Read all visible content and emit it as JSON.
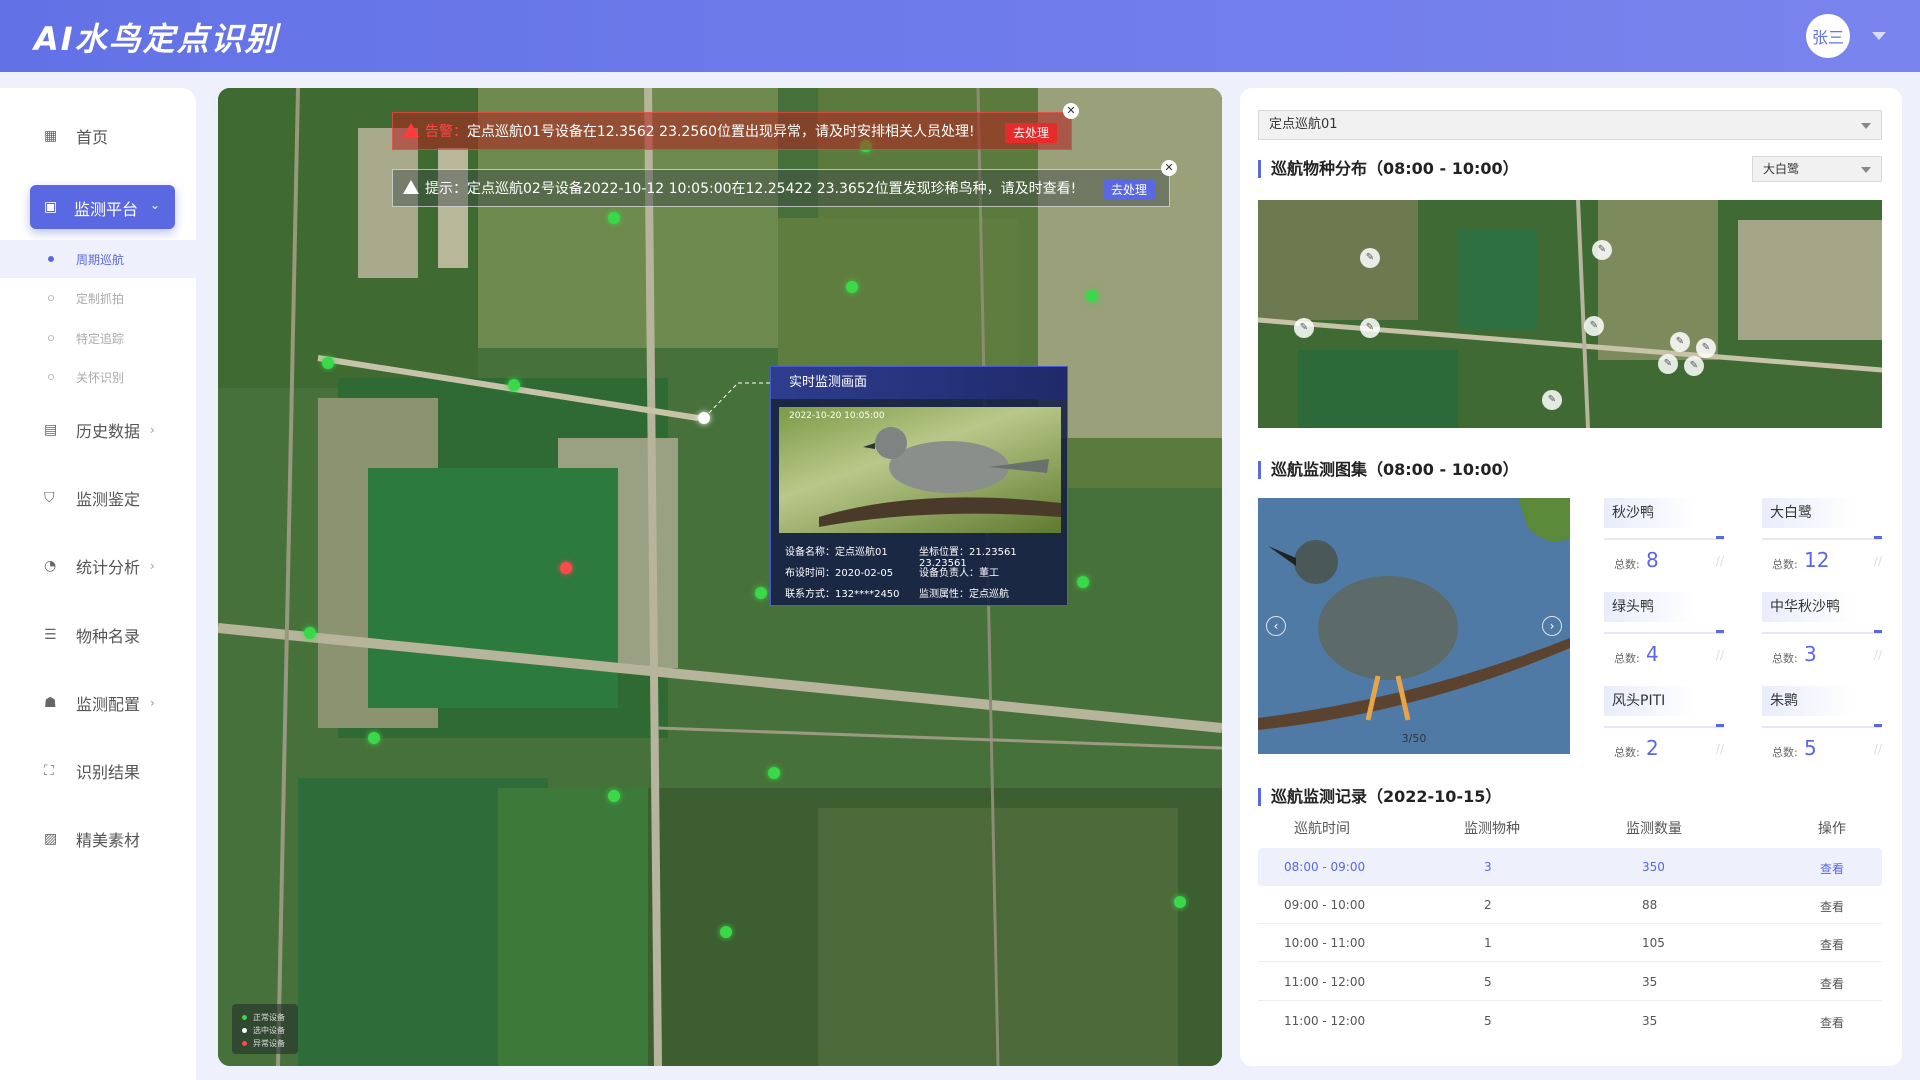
{
  "app": {
    "title": "AI水鸟定点识别",
    "user": "张三"
  },
  "nav": {
    "home": "首页",
    "monitor": "监测平台",
    "sub": [
      "周期巡航",
      "定制抓拍",
      "特定追踪",
      "关怀识别"
    ],
    "history": "历史数据",
    "appraise": "监测鉴定",
    "stats": "统计分析",
    "species": "物种名录",
    "config": "监测配置",
    "results": "识别结果",
    "media": "精美素材"
  },
  "alerts": {
    "warn": {
      "prefix": "告警：",
      "text": "定点巡航01号设备在12.3562  23.2560位置出现异常，请及时安排相关人员处理!",
      "button": "去处理"
    },
    "tip": {
      "prefix": "提示：",
      "text": "定点巡航02号设备2022-10-12 10:05:00在12.25422  23.3652位置发现珍稀鸟种，请及时查看!",
      "button": "去处理"
    }
  },
  "popup": {
    "title": "实时监测画面",
    "timestamp": "2022-10-20  10:05:00",
    "device_name_label": "设备名称：",
    "device_name": "定点巡航01",
    "coord_label": "坐标位置：",
    "coord": "21.23561  23.23561",
    "setup_label": "布设时间：",
    "setup": "2020-02-05",
    "owner_label": "设备负责人：",
    "owner": "董工",
    "contact_label": "联系方式：",
    "contact": "132****2450",
    "attr_label": "监测属性：",
    "attr": "定点巡航"
  },
  "legend": [
    "正常设备",
    "选中设备",
    "异常设备"
  ],
  "panel": {
    "route_select": "定点巡航01",
    "dist_title": "巡航物种分布（08:00 - 10:00）",
    "species_select": "大白鹭",
    "gallery_title": "巡航监测图集（08:00 - 10:00）",
    "gallery_count": "3/50",
    "stats_total_label": "总数:",
    "stats": [
      {
        "name": "秋沙鸭",
        "value": "8"
      },
      {
        "name": "大白鹭",
        "value": "12"
      },
      {
        "name": "绿头鸭",
        "value": "4"
      },
      {
        "name": "中华秋沙鸭",
        "value": "3"
      },
      {
        "name": "风头PITI",
        "value": "2"
      },
      {
        "name": "朱鹮",
        "value": "5"
      }
    ],
    "records_title": "巡航监测记录（2022-10-15）",
    "table_headers": [
      "巡航时间",
      "监测物种",
      "监测数量",
      "操作"
    ],
    "rows": [
      {
        "time": "08:00 - 09:00",
        "species": "3",
        "count": "350",
        "op": "查看"
      },
      {
        "time": "09:00 - 10:00",
        "species": "2",
        "count": "88",
        "op": "查看"
      },
      {
        "time": "10:00 - 11:00",
        "species": "1",
        "count": "105",
        "op": "查看"
      },
      {
        "time": "11:00 - 12:00",
        "species": "5",
        "count": "35",
        "op": "查看"
      },
      {
        "time": "11:00 - 12:00",
        "species": "5",
        "count": "35",
        "op": "查看"
      }
    ]
  },
  "colors": {
    "accent": "#5a68e2",
    "alert": "#e72a2a",
    "device_normal": "#39d94a",
    "device_selected": "#ffffff",
    "device_abnormal": "#ff4a4a"
  }
}
